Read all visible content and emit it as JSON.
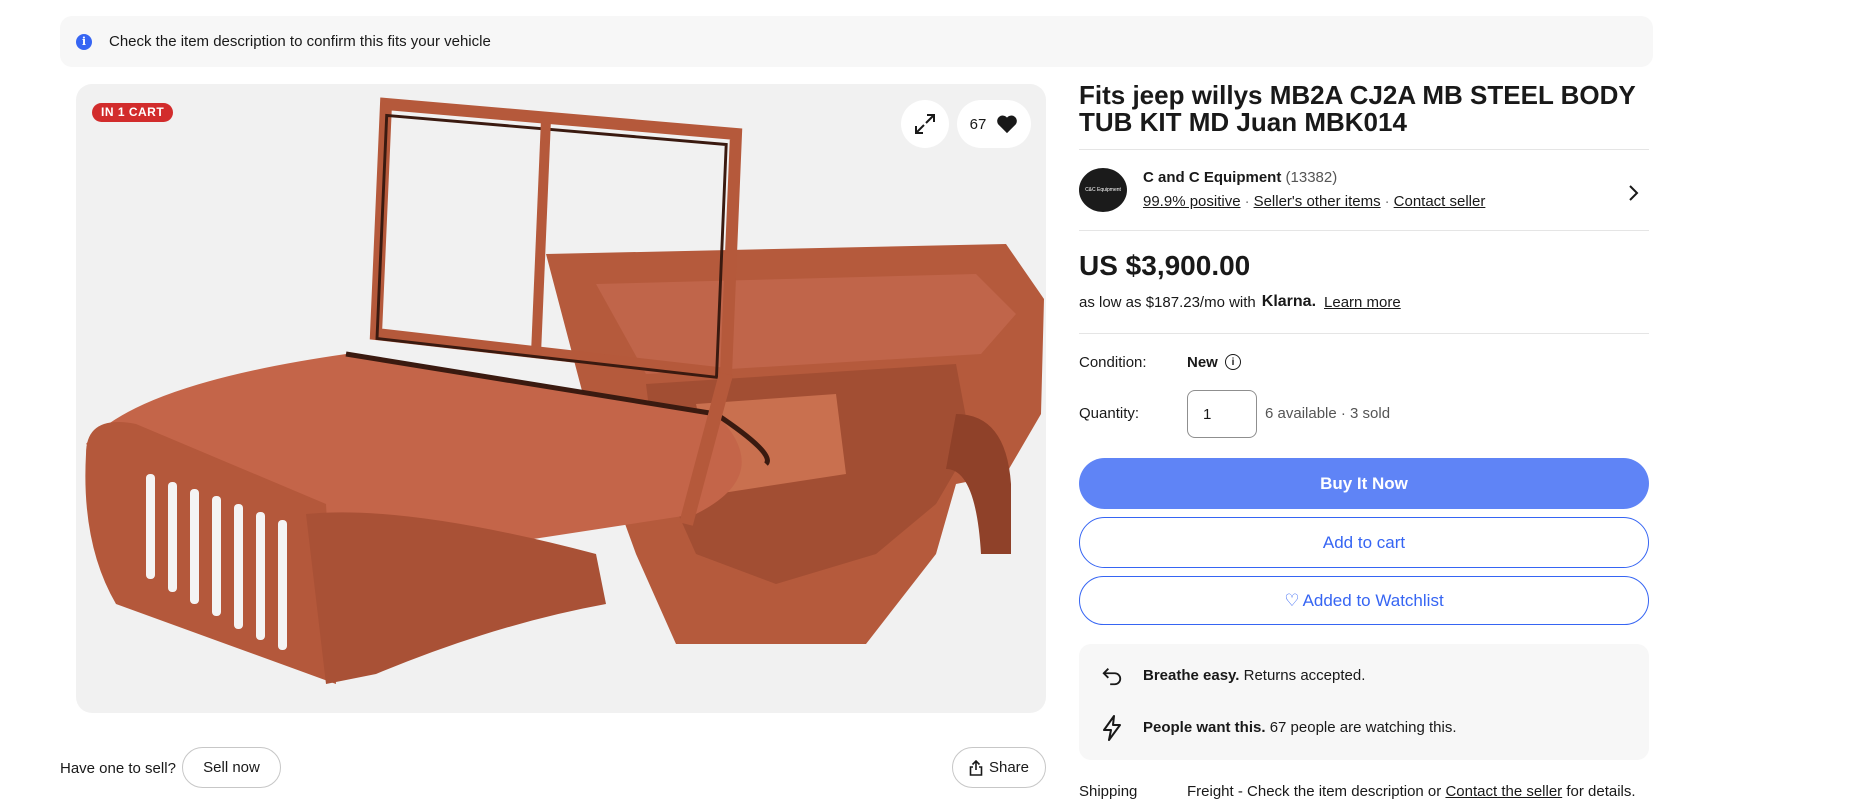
{
  "notice": {
    "text": "Check the item description to confirm this fits your vehicle"
  },
  "gallery": {
    "cart_badge": "IN 1 CART",
    "watch_count": "67",
    "image_alt": "Jeep steel body tub painted in red oxide primer"
  },
  "listing": {
    "title": "Fits jeep willys MB2A CJ2A MB STEEL BODY TUB KIT MD Juan MBK014",
    "price": "US $3,900.00"
  },
  "seller": {
    "logo_text": "C&C Equipment",
    "name": "C and C Equipment",
    "feedback_count": "(13382)",
    "positive": "99.9% positive",
    "other_items": "Seller's other items",
    "contact": "Contact seller"
  },
  "financing": {
    "prefix": "as low as $187.23/mo with",
    "brand": "Klarna.",
    "learn_more": "Learn more"
  },
  "condition": {
    "label": "Condition:",
    "value": "New"
  },
  "quantity": {
    "label": "Quantity:",
    "value": "1",
    "availability": "6 available · 3 sold"
  },
  "actions": {
    "buy_now": "Buy It Now",
    "add_to_cart": "Add to cart",
    "watchlist": "Added to Watchlist",
    "sell_now": "Sell now",
    "share": "Share"
  },
  "highlights": {
    "returns_bold": "Breathe easy.",
    "returns_text": "Returns accepted.",
    "demand_bold": "People want this.",
    "demand_text": "67 people are watching this."
  },
  "sell_prompt": "Have one to sell?",
  "shipping": {
    "label": "Shipping",
    "text": "Freight - Check the item description or",
    "contact_link": "Contact the seller",
    "suffix": "for details."
  },
  "colors": {
    "accent": "#3665f3",
    "buy_now": "#5f84f6",
    "badge": "#d22c2c"
  }
}
